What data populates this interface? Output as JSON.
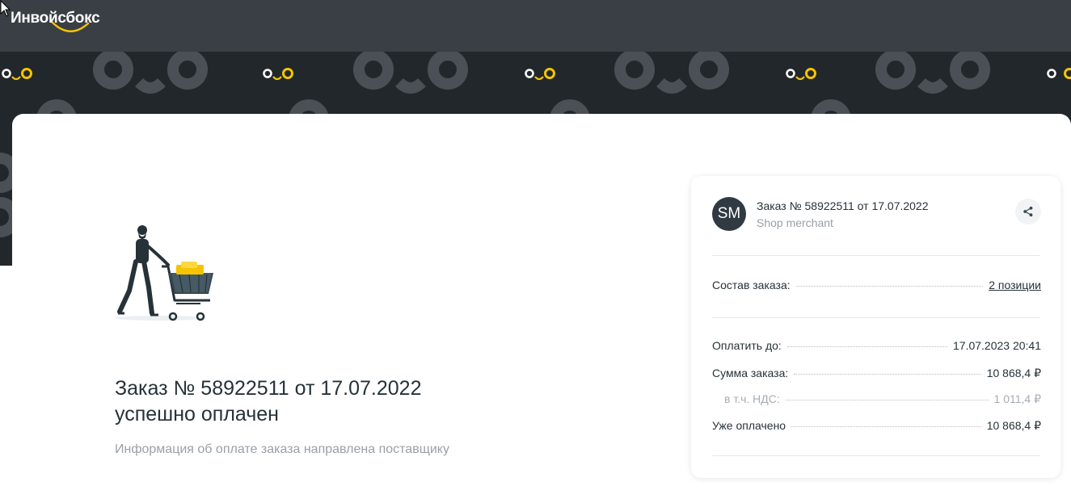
{
  "brand": {
    "name": "Инвойсбокс",
    "accent_color": "#f5c400",
    "header_color": "#3a3f45",
    "pattern_color": "#22272b"
  },
  "main": {
    "title": "Заказ № 58922511 от 17.07.2022",
    "title_status": "успешно оплачен",
    "subtitle": "Информация об оплате заказа направлена поставщику",
    "illustration": "shopper-with-cart-illustration"
  },
  "summary": {
    "avatar_initials": "SM",
    "order_title": "Заказ № 58922511 от 17.07.2022",
    "merchant": "Shop merchant",
    "share_icon": "share-icon",
    "composition_label": "Состав заказа:",
    "composition_value": "2 позиции",
    "rows": [
      {
        "label": "Оплатить до:",
        "value": "17.07.2023 20:41"
      },
      {
        "label": "Сумма заказа:",
        "value": "10 868,4 ₽"
      },
      {
        "label": "в т.ч. НДС:",
        "value": "1 011,4 ₽"
      },
      {
        "label": "Уже оплачено",
        "value": "10 868,4 ₽"
      }
    ]
  }
}
